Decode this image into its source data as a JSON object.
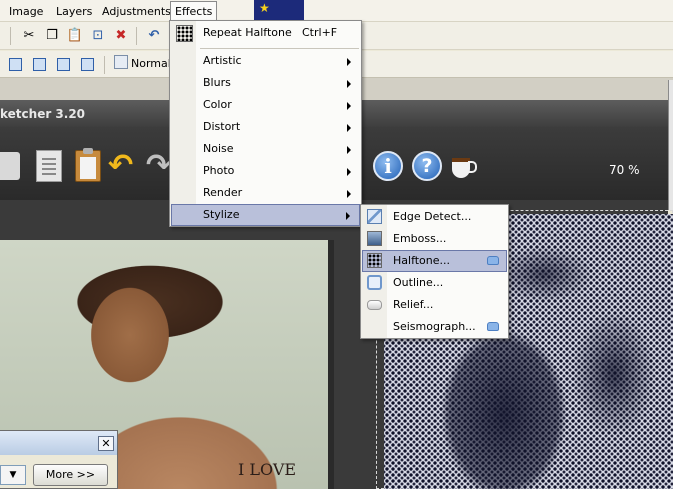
{
  "menubar": {
    "items": [
      "Image",
      "Layers",
      "Adjustments",
      "Effects"
    ]
  },
  "toolbar": {
    "blend_mode": "Normal"
  },
  "sketcher": {
    "title": "ketcher 3.20",
    "zoom": "70 %",
    "tattoo_text": "I LOVE"
  },
  "effects_menu": {
    "repeat_label": "Repeat Halftone",
    "repeat_shortcut": "Ctrl+F",
    "items": [
      "Artistic",
      "Blurs",
      "Color",
      "Distort",
      "Noise",
      "Photo",
      "Render",
      "Stylize"
    ],
    "selected": "Stylize"
  },
  "stylize_menu": {
    "items": [
      "Edge Detect...",
      "Emboss...",
      "Halftone...",
      "Outline...",
      "Relief...",
      "Seismograph..."
    ],
    "selected": "Halftone..."
  },
  "small_dialog": {
    "close_glyph": "✕",
    "more_label": "More >>"
  },
  "colors": {
    "selection_bg": "#b9c0da",
    "sketcher_bg": "#3a3a3a",
    "halftone_ink": "#10122a"
  },
  "icons": [
    "scissors-icon",
    "copy-icon",
    "paste-icon",
    "crop-icon",
    "deselect-icon",
    "undo-icon",
    "info-icon",
    "help-icon",
    "coffee-cup-icon",
    "halftone-icon",
    "edge-detect-icon",
    "emboss-icon",
    "outline-icon",
    "relief-icon",
    "plugin-icon"
  ]
}
